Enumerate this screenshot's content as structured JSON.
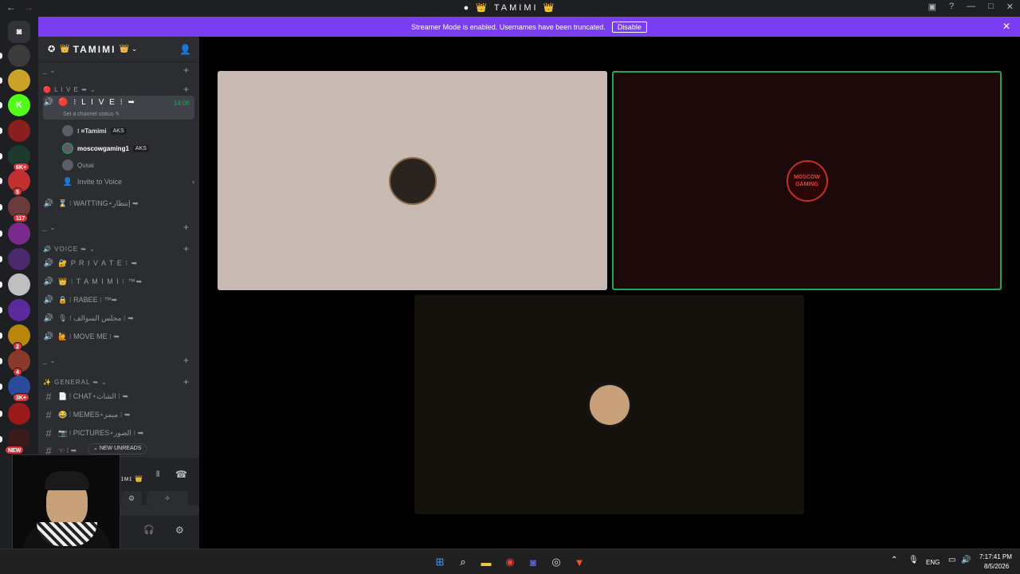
{
  "titlebar": {
    "title": "TAMIMI",
    "crown_glyph": "👑"
  },
  "guilds": [
    {
      "name": "discord-home",
      "badge": "",
      "color": "#313338"
    },
    {
      "name": "server-1",
      "badge": "",
      "color": "#3b3b3b"
    },
    {
      "name": "server-2",
      "badge": "",
      "color": "#c9a227"
    },
    {
      "name": "server-kick",
      "badge": "",
      "color": "#53fc18"
    },
    {
      "name": "server-3",
      "badge": "",
      "color": "#8b1e1e"
    },
    {
      "name": "server-4",
      "badge": "6K+",
      "color": "#1c3a2e"
    },
    {
      "name": "server-5",
      "badge": "5",
      "color": "#c0302e"
    },
    {
      "name": "server-6",
      "badge": "117",
      "color": "#6b3a3a"
    },
    {
      "name": "server-7",
      "badge": "",
      "color": "#7a2a8a"
    },
    {
      "name": "server-8",
      "badge": "",
      "color": "#4a2a6a"
    },
    {
      "name": "server-9",
      "badge": "",
      "color": "#bfbfbf"
    },
    {
      "name": "server-10",
      "badge": "",
      "color": "#5a2a9a"
    },
    {
      "name": "server-11",
      "badge": "2",
      "color": "#b8860b"
    },
    {
      "name": "server-12",
      "badge": "4",
      "color": "#8a3a2a"
    },
    {
      "name": "server-13",
      "badge": "3K+",
      "color": "#2a4a9a"
    },
    {
      "name": "server-14",
      "badge": "",
      "color": "#9a1a1a"
    },
    {
      "name": "server-15",
      "badge": "NEW",
      "color": "#3a1a1a"
    }
  ],
  "banner": {
    "text": "Streamer Mode is enabled. Usernames have been truncated.",
    "button": "Disable"
  },
  "sidebar": {
    "server_name": "TAMIMI",
    "cat1": {
      "label": "_ ⌄"
    },
    "live_cat": {
      "label": "🔴 L I V E ➥ ⌄"
    },
    "live_channel": {
      "label": "🔴 ⁝ L I V E ⁝ ➥",
      "time": "14:06",
      "status": "Set a channel status ✎"
    },
    "members": [
      {
        "name": "⁝ ¤Tamimi",
        "tag": "AKS"
      },
      {
        "name": "moscowgaming1",
        "tag": "AKS"
      },
      {
        "name": "Qusai",
        "tag": ""
      }
    ],
    "invite": "Invite to Voice",
    "waiting": "⌛ ⁝ WAITTING⋆إنتظار ➥",
    "cat2": {
      "label": "_ ⌄"
    },
    "voice_cat": {
      "label": "🔊 VOICE ➥ ⌄"
    },
    "voice_channels": [
      "🔐 P R I V A T E ⁝ ➥",
      "👑 ⁝ T A M I M I ⁝ ™➥",
      "🔒 ⁝ RABEE ⁝ ™➥",
      "🎙 ⁝ مجلس السوالف ⁝ ➥",
      "🙋 ⁝ MOVE ME ⁝ ➥"
    ],
    "cat3": {
      "label": "_ ⌄"
    },
    "general_cat": {
      "label": "✨ GENERAL ➥ ⌄"
    },
    "text_channels": [
      "📄 ⁞ CHAT⋆الشات ⁝ ➥",
      "😂 ⁞ MEMES⋆ميمز ⁝ ➥",
      "📷 ⁞ PICTURES⋆الصور ⁝ ➥",
      "☜ ⁞ ➥"
    ],
    "new_unreads": "NEW UNREADS",
    "voice_panel_name": "ɪᴍɪ 👑"
  },
  "stage": {
    "tiles": [
      {
        "name": "tile-tamimi",
        "bg": "#c8bab2"
      },
      {
        "name": "tile-moscowgaming",
        "bg": "#1c0a0a",
        "speaking": true
      },
      {
        "name": "tile-qusai",
        "bg": "#15120d"
      }
    ],
    "logo_text": "MOSCOW GAMING"
  },
  "taskbar": {
    "lang": "ENG",
    "time": "7:17:41 PM",
    "date": "8/5/2026"
  }
}
